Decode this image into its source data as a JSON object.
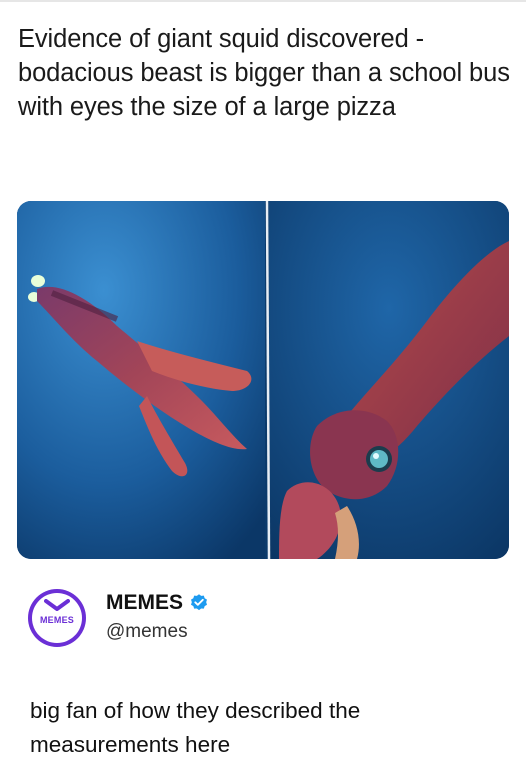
{
  "headline": "Evidence of giant squid discovered - bodacious beast is bigger than a school bus with eyes the size of a large pizza",
  "media": {
    "left_image": "squid-swimming-photo",
    "right_image": "squid-closeup-eye-photo",
    "colors": {
      "water_dark": "#08345f",
      "water_light": "#2e7cc0",
      "squid": "#b8434f"
    }
  },
  "author": {
    "avatar_text": "MEMES",
    "display_name": "MEMES",
    "handle": "@memes",
    "verified": true,
    "avatar_color": "#6b2fd6",
    "verified_color": "#1d9bf0"
  },
  "post_text": "big fan of how they described the measurements here"
}
